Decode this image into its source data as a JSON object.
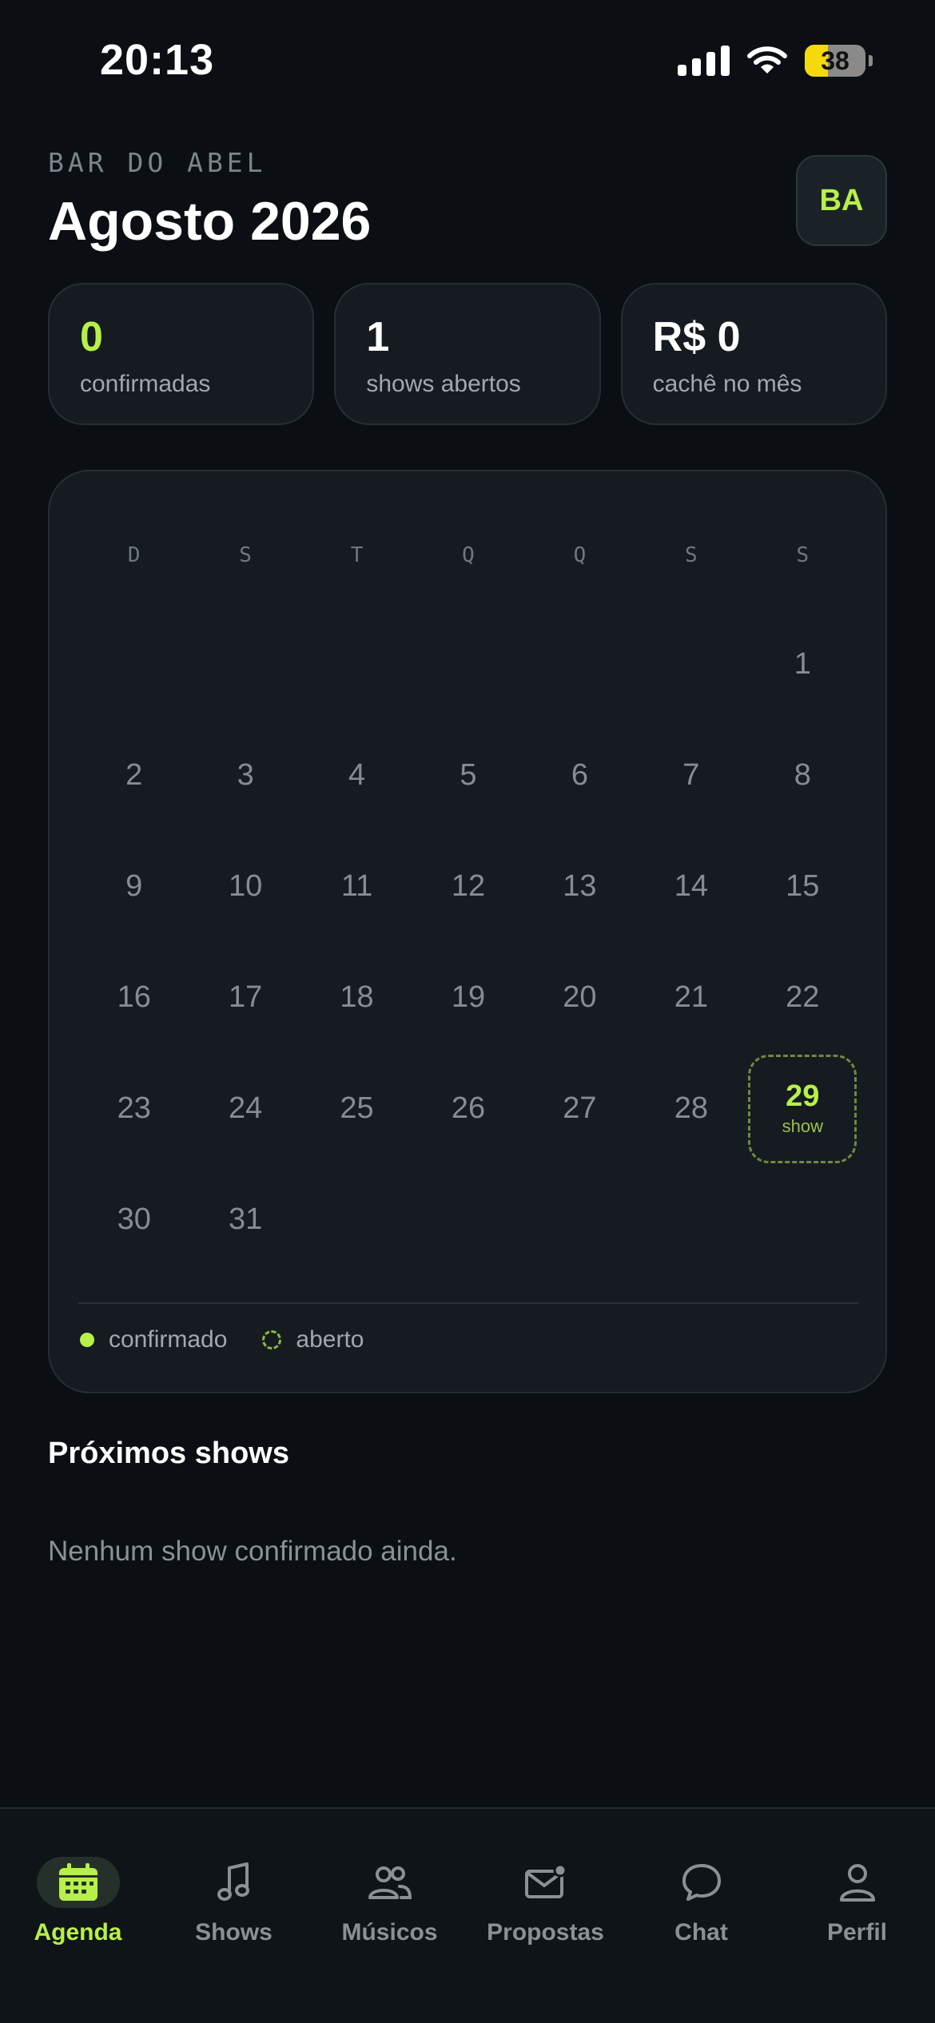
{
  "status_bar": {
    "time": "20:13",
    "battery_level": "38",
    "icons": [
      "signal-icon",
      "wifi-icon",
      "battery-icon"
    ]
  },
  "header": {
    "venue": "BAR DO ABEL",
    "title": "Agosto 2026",
    "avatar_initials": "BA"
  },
  "stats": [
    {
      "value": "0",
      "label": "confirmadas"
    },
    {
      "value": "1",
      "label": "shows abertos"
    },
    {
      "value": "R$ 0",
      "label": "cachê no mês"
    }
  ],
  "calendar": {
    "weekdays": [
      "D",
      "S",
      "T",
      "Q",
      "Q",
      "S",
      "S"
    ],
    "days": [
      "1",
      "2",
      "3",
      "4",
      "5",
      "6",
      "7",
      "8",
      "9",
      "10",
      "11",
      "12",
      "13",
      "14",
      "15",
      "16",
      "17",
      "18",
      "19",
      "20",
      "21",
      "22",
      "23",
      "24",
      "25",
      "26",
      "27",
      "28",
      "29",
      "30",
      "31"
    ],
    "show_day": "29",
    "show_tag": "show",
    "legend": {
      "confirmed": "confirmado",
      "open": "aberto"
    }
  },
  "upcoming": {
    "title": "Próximos shows",
    "empty": "Nenhum show confirmado ainda."
  },
  "nav": [
    {
      "label": "Agenda",
      "icon": "calendar-icon",
      "active": true
    },
    {
      "label": "Shows",
      "icon": "music-note-icon",
      "active": false
    },
    {
      "label": "Músicos",
      "icon": "users-icon",
      "active": false
    },
    {
      "label": "Propostas",
      "icon": "mail-icon",
      "active": false
    },
    {
      "label": "Chat",
      "icon": "chat-bubble-icon",
      "active": false
    },
    {
      "label": "Perfil",
      "icon": "profile-icon",
      "active": false
    }
  ],
  "colors": {
    "accent": "#b8f04a",
    "background": "#0b0f13",
    "card": "#151b20"
  }
}
